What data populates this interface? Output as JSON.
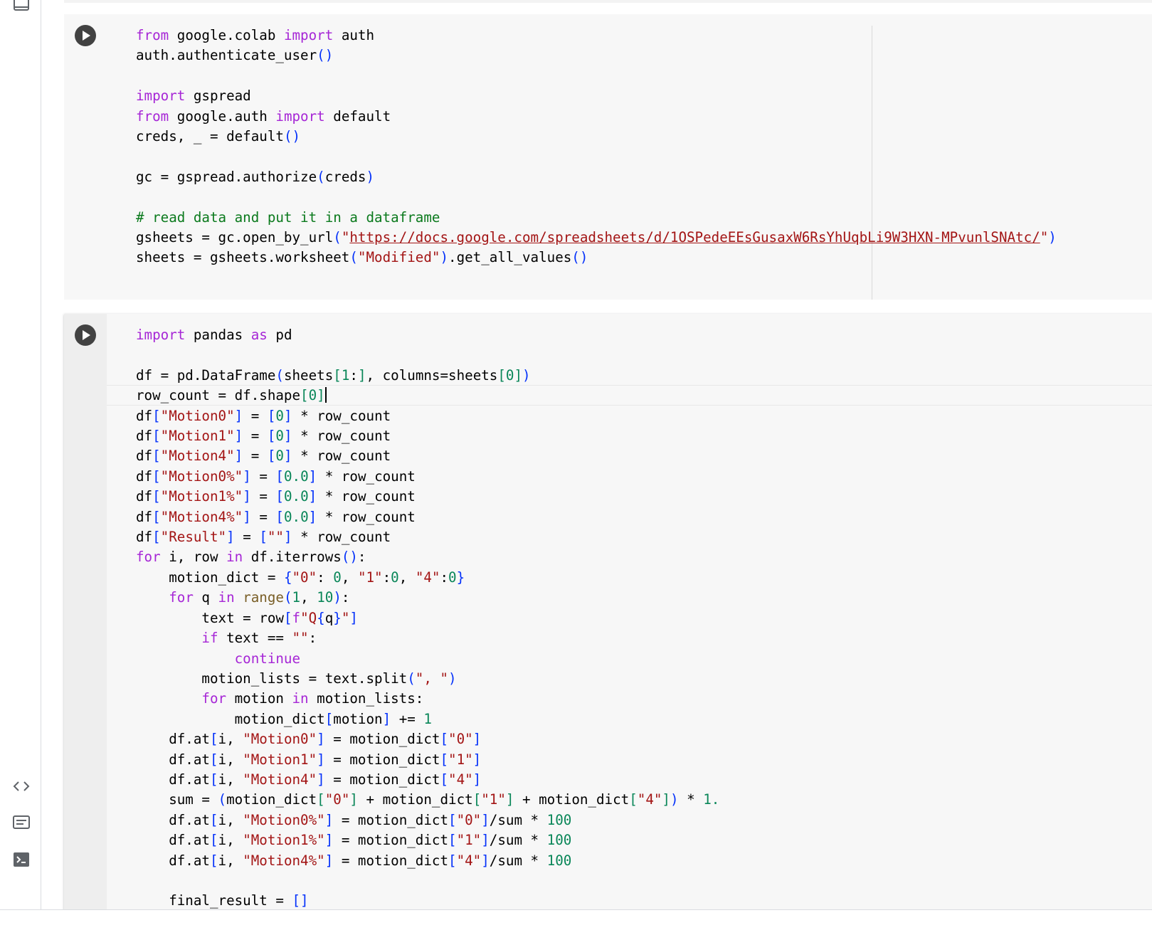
{
  "sidebar": {
    "icons": [
      "panel-icon",
      "code-snippets-icon",
      "command-palette-icon",
      "terminal-icon"
    ]
  },
  "colors": {
    "keyword": "#a626d6",
    "string": "#a31515",
    "number": "#098658",
    "bracket": "#0431fa",
    "comment": "#0b7a1d",
    "builtin": "#795e26",
    "url": "#a31515"
  },
  "cells": [
    {
      "lines": [
        [
          [
            "k",
            "from"
          ],
          [
            "p",
            " google.colab "
          ],
          [
            "k",
            "import"
          ],
          [
            "p",
            " auth"
          ]
        ],
        [
          [
            "p",
            "auth.authenticate_user"
          ],
          [
            "b",
            "()"
          ]
        ],
        [],
        [
          [
            "k",
            "import"
          ],
          [
            "p",
            " gspread"
          ]
        ],
        [
          [
            "k",
            "from"
          ],
          [
            "p",
            " google.auth "
          ],
          [
            "k",
            "import"
          ],
          [
            "p",
            " default"
          ]
        ],
        [
          [
            "p",
            "creds, _ = default"
          ],
          [
            "b",
            "()"
          ]
        ],
        [],
        [
          [
            "p",
            "gc = gspread.authorize"
          ],
          [
            "b",
            "("
          ],
          [
            "p",
            "creds"
          ],
          [
            "b",
            ")"
          ]
        ],
        [],
        [
          [
            "c",
            "# read data and put it in a dataframe"
          ]
        ],
        [
          [
            "p",
            "gsheets = gc.open_by_url"
          ],
          [
            "b",
            "("
          ],
          [
            "s",
            "\""
          ],
          [
            "u",
            "https://docs.google.com/spreadsheets/d/1OSPedeEEsGusaxW6RsYhUqbLi9W3HXN-MPvunlSNAtc/"
          ],
          [
            "s",
            "\""
          ],
          [
            "b",
            ")"
          ]
        ],
        [
          [
            "p",
            "sheets = gsheets.worksheet"
          ],
          [
            "b",
            "("
          ],
          [
            "s",
            "\"Modified\""
          ],
          [
            "b",
            ")"
          ],
          [
            "p",
            ".get_all_values"
          ],
          [
            "b",
            "()"
          ]
        ]
      ]
    },
    {
      "lines": [
        [
          [
            "k",
            "import"
          ],
          [
            "p",
            " pandas "
          ],
          [
            "k",
            "as"
          ],
          [
            "p",
            " pd"
          ]
        ],
        [],
        [
          [
            "p",
            "df = pd.DataFrame"
          ],
          [
            "b",
            "("
          ],
          [
            "p",
            "sheets"
          ],
          [
            "g",
            "["
          ],
          [
            "n",
            "1"
          ],
          [
            "p",
            ":"
          ],
          [
            "g",
            "]"
          ],
          [
            "p",
            ", columns=sheets"
          ],
          [
            "g",
            "["
          ],
          [
            "n",
            "0"
          ],
          [
            "g",
            "]"
          ],
          [
            "b",
            ")"
          ]
        ],
        [
          [
            "p",
            "row_count = df.shape"
          ],
          [
            "g",
            "["
          ],
          [
            "n",
            "0"
          ],
          [
            "g",
            "]"
          ],
          [
            "cursor",
            ""
          ]
        ],
        [
          [
            "p",
            "df"
          ],
          [
            "b",
            "["
          ],
          [
            "s",
            "\"Motion0\""
          ],
          [
            "b",
            "]"
          ],
          [
            "p",
            " = "
          ],
          [
            "b",
            "["
          ],
          [
            "n",
            "0"
          ],
          [
            "b",
            "]"
          ],
          [
            "p",
            " * row_count"
          ]
        ],
        [
          [
            "p",
            "df"
          ],
          [
            "b",
            "["
          ],
          [
            "s",
            "\"Motion1\""
          ],
          [
            "b",
            "]"
          ],
          [
            "p",
            " = "
          ],
          [
            "b",
            "["
          ],
          [
            "n",
            "0"
          ],
          [
            "b",
            "]"
          ],
          [
            "p",
            " * row_count"
          ]
        ],
        [
          [
            "p",
            "df"
          ],
          [
            "b",
            "["
          ],
          [
            "s",
            "\"Motion4\""
          ],
          [
            "b",
            "]"
          ],
          [
            "p",
            " = "
          ],
          [
            "b",
            "["
          ],
          [
            "n",
            "0"
          ],
          [
            "b",
            "]"
          ],
          [
            "p",
            " * row_count"
          ]
        ],
        [
          [
            "p",
            "df"
          ],
          [
            "b",
            "["
          ],
          [
            "s",
            "\"Motion0%\""
          ],
          [
            "b",
            "]"
          ],
          [
            "p",
            " = "
          ],
          [
            "b",
            "["
          ],
          [
            "n",
            "0.0"
          ],
          [
            "b",
            "]"
          ],
          [
            "p",
            " * row_count"
          ]
        ],
        [
          [
            "p",
            "df"
          ],
          [
            "b",
            "["
          ],
          [
            "s",
            "\"Motion1%\""
          ],
          [
            "b",
            "]"
          ],
          [
            "p",
            " = "
          ],
          [
            "b",
            "["
          ],
          [
            "n",
            "0.0"
          ],
          [
            "b",
            "]"
          ],
          [
            "p",
            " * row_count"
          ]
        ],
        [
          [
            "p",
            "df"
          ],
          [
            "b",
            "["
          ],
          [
            "s",
            "\"Motion4%\""
          ],
          [
            "b",
            "]"
          ],
          [
            "p",
            " = "
          ],
          [
            "b",
            "["
          ],
          [
            "n",
            "0.0"
          ],
          [
            "b",
            "]"
          ],
          [
            "p",
            " * row_count"
          ]
        ],
        [
          [
            "p",
            "df"
          ],
          [
            "b",
            "["
          ],
          [
            "s",
            "\"Result\""
          ],
          [
            "b",
            "]"
          ],
          [
            "p",
            " = "
          ],
          [
            "b",
            "["
          ],
          [
            "s",
            "\"\""
          ],
          [
            "b",
            "]"
          ],
          [
            "p",
            " * row_count"
          ]
        ],
        [
          [
            "k",
            "for"
          ],
          [
            "p",
            " i, row "
          ],
          [
            "k",
            "in"
          ],
          [
            "p",
            " df.iterrows"
          ],
          [
            "b",
            "()"
          ],
          [
            "p",
            ":"
          ]
        ],
        [
          [
            "p",
            "    motion_dict = "
          ],
          [
            "b",
            "{"
          ],
          [
            "s",
            "\"0\""
          ],
          [
            "p",
            ": "
          ],
          [
            "n",
            "0"
          ],
          [
            "p",
            ", "
          ],
          [
            "s",
            "\"1\""
          ],
          [
            "p",
            ":"
          ],
          [
            "n",
            "0"
          ],
          [
            "p",
            ", "
          ],
          [
            "s",
            "\"4\""
          ],
          [
            "p",
            ":"
          ],
          [
            "n",
            "0"
          ],
          [
            "b",
            "}"
          ]
        ],
        [
          [
            "p",
            "    "
          ],
          [
            "k",
            "for"
          ],
          [
            "p",
            " q "
          ],
          [
            "k",
            "in"
          ],
          [
            "p",
            " "
          ],
          [
            "f",
            "range"
          ],
          [
            "b",
            "("
          ],
          [
            "n",
            "1"
          ],
          [
            "p",
            ", "
          ],
          [
            "n",
            "10"
          ],
          [
            "b",
            ")"
          ],
          [
            "p",
            ":"
          ]
        ],
        [
          [
            "p",
            "        text = row"
          ],
          [
            "b",
            "["
          ],
          [
            "k",
            "f"
          ],
          [
            "s",
            "\"Q"
          ],
          [
            "b",
            "{"
          ],
          [
            "p",
            "q"
          ],
          [
            "b",
            "}"
          ],
          [
            "s",
            "\""
          ],
          [
            "b",
            "]"
          ]
        ],
        [
          [
            "p",
            "        "
          ],
          [
            "k",
            "if"
          ],
          [
            "p",
            " text == "
          ],
          [
            "s",
            "\"\""
          ],
          [
            "p",
            ":"
          ]
        ],
        [
          [
            "p",
            "            "
          ],
          [
            "k",
            "continue"
          ]
        ],
        [
          [
            "p",
            "        motion_lists = text.split"
          ],
          [
            "b",
            "("
          ],
          [
            "s",
            "\", \""
          ],
          [
            "b",
            ")"
          ]
        ],
        [
          [
            "p",
            "        "
          ],
          [
            "k",
            "for"
          ],
          [
            "p",
            " motion "
          ],
          [
            "k",
            "in"
          ],
          [
            "p",
            " motion_lists:"
          ]
        ],
        [
          [
            "p",
            "            motion_dict"
          ],
          [
            "b",
            "["
          ],
          [
            "p",
            "motion"
          ],
          [
            "b",
            "]"
          ],
          [
            "p",
            " += "
          ],
          [
            "n",
            "1"
          ]
        ],
        [
          [
            "p",
            "    df.at"
          ],
          [
            "b",
            "["
          ],
          [
            "p",
            "i, "
          ],
          [
            "s",
            "\"Motion0\""
          ],
          [
            "b",
            "]"
          ],
          [
            "p",
            " = motion_dict"
          ],
          [
            "b",
            "["
          ],
          [
            "s",
            "\"0\""
          ],
          [
            "b",
            "]"
          ]
        ],
        [
          [
            "p",
            "    df.at"
          ],
          [
            "b",
            "["
          ],
          [
            "p",
            "i, "
          ],
          [
            "s",
            "\"Motion1\""
          ],
          [
            "b",
            "]"
          ],
          [
            "p",
            " = motion_dict"
          ],
          [
            "b",
            "["
          ],
          [
            "s",
            "\"1\""
          ],
          [
            "b",
            "]"
          ]
        ],
        [
          [
            "p",
            "    df.at"
          ],
          [
            "b",
            "["
          ],
          [
            "p",
            "i, "
          ],
          [
            "s",
            "\"Motion4\""
          ],
          [
            "b",
            "]"
          ],
          [
            "p",
            " = motion_dict"
          ],
          [
            "b",
            "["
          ],
          [
            "s",
            "\"4\""
          ],
          [
            "b",
            "]"
          ]
        ],
        [
          [
            "p",
            "    sum = "
          ],
          [
            "b",
            "("
          ],
          [
            "p",
            "motion_dict"
          ],
          [
            "g",
            "["
          ],
          [
            "s",
            "\"0\""
          ],
          [
            "g",
            "]"
          ],
          [
            "p",
            " + motion_dict"
          ],
          [
            "g",
            "["
          ],
          [
            "s",
            "\"1\""
          ],
          [
            "g",
            "]"
          ],
          [
            "p",
            " + motion_dict"
          ],
          [
            "g",
            "["
          ],
          [
            "s",
            "\"4\""
          ],
          [
            "g",
            "]"
          ],
          [
            "b",
            ")"
          ],
          [
            "p",
            " * "
          ],
          [
            "n",
            "1."
          ]
        ],
        [
          [
            "p",
            "    df.at"
          ],
          [
            "b",
            "["
          ],
          [
            "p",
            "i, "
          ],
          [
            "s",
            "\"Motion0%\""
          ],
          [
            "b",
            "]"
          ],
          [
            "p",
            " = motion_dict"
          ],
          [
            "b",
            "["
          ],
          [
            "s",
            "\"0\""
          ],
          [
            "b",
            "]"
          ],
          [
            "p",
            "/sum * "
          ],
          [
            "n",
            "100"
          ]
        ],
        [
          [
            "p",
            "    df.at"
          ],
          [
            "b",
            "["
          ],
          [
            "p",
            "i, "
          ],
          [
            "s",
            "\"Motion1%\""
          ],
          [
            "b",
            "]"
          ],
          [
            "p",
            " = motion_dict"
          ],
          [
            "b",
            "["
          ],
          [
            "s",
            "\"1\""
          ],
          [
            "b",
            "]"
          ],
          [
            "p",
            "/sum * "
          ],
          [
            "n",
            "100"
          ]
        ],
        [
          [
            "p",
            "    df.at"
          ],
          [
            "b",
            "["
          ],
          [
            "p",
            "i, "
          ],
          [
            "s",
            "\"Motion4%\""
          ],
          [
            "b",
            "]"
          ],
          [
            "p",
            " = motion_dict"
          ],
          [
            "b",
            "["
          ],
          [
            "s",
            "\"4\""
          ],
          [
            "b",
            "]"
          ],
          [
            "p",
            "/sum * "
          ],
          [
            "n",
            "100"
          ]
        ],
        [],
        [
          [
            "p",
            "    final_result = "
          ],
          [
            "b",
            "[]"
          ]
        ]
      ]
    }
  ]
}
